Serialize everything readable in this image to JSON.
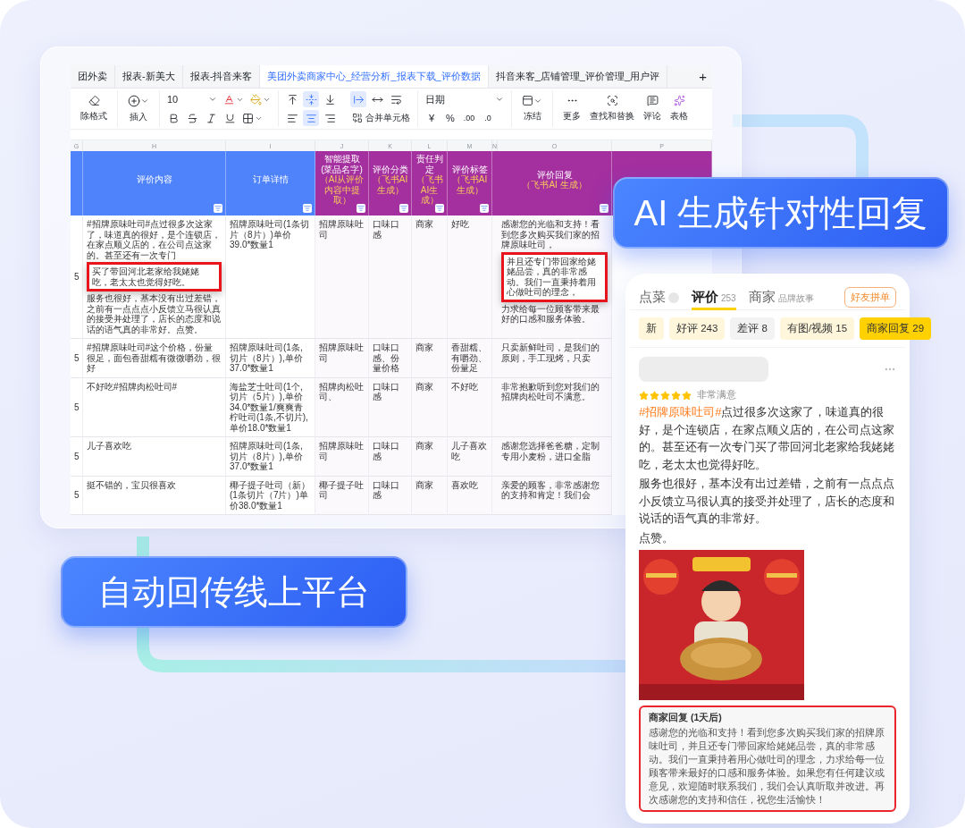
{
  "sheet": {
    "tabs": [
      {
        "label": "团外卖",
        "selected": false
      },
      {
        "label": "报表-新美大",
        "selected": false
      },
      {
        "label": "报表-抖音来客",
        "selected": false
      },
      {
        "label": "美团外卖商家中心_经营分析_报表下载_评价数据",
        "selected": true
      },
      {
        "label": "抖音来客_店铺管理_评价管理_用户评",
        "selected": false
      }
    ],
    "add_tab": "+",
    "toolbar": {
      "clear_format": "除格式",
      "insert": "插入",
      "font_size": "10",
      "vertical_align": [
        {
          "selected": false
        },
        {
          "selected": true
        },
        {
          "selected": false
        }
      ],
      "text_wrap": [
        {
          "selected": true
        },
        {
          "selected": false
        },
        {
          "selected": false
        }
      ],
      "horizontal_align": [
        {
          "selected": false
        },
        {
          "selected": true
        },
        {
          "selected": false
        }
      ],
      "merge_cells": "合并单元格",
      "number_format": "日期",
      "currency": "¥",
      "percent": "%",
      "add_decimal": ".00",
      "remove_decimal": ".0",
      "freeze": "冻结",
      "more": "更多",
      "find_replace": "查找和替换",
      "comment": "评论",
      "table": "表格"
    },
    "column_letters": [
      "G",
      "H",
      "I",
      "J",
      "K",
      "L",
      "M",
      "N",
      "O",
      "P"
    ],
    "headers": [
      {
        "kind": "source"
      },
      {
        "kind": "source",
        "title": "评价内容"
      },
      {
        "kind": "source",
        "title": "订单详情"
      },
      {
        "kind": "ai",
        "title": "智能提取(菜品名字)",
        "sub": "（AI从评价内容中提取）"
      },
      {
        "kind": "ai",
        "title": "评价分类",
        "sub": "（飞书AI生成）"
      },
      {
        "kind": "ai",
        "title": "责任判定",
        "sub": "（飞书AI生成）"
      },
      {
        "kind": "ai",
        "title": "评价标签",
        "sub": "（飞书AI 生成）"
      },
      {
        "kind": "ai"
      },
      {
        "kind": "ai",
        "title": "评价回复",
        "sub": "（飞书AI 生成）"
      },
      {
        "kind": "ai"
      }
    ],
    "rows": [
      {
        "cells": [
          "5",
          {
            "segments": [
              {
                "kind": "text",
                "text": "#招牌原味吐司#点过很多次这家了，味道真的很好，是个连锁店，在家点顺义店的，在公司点这家的。甚至还有一次专门"
              },
              {
                "kind": "highlight",
                "text": "买了带回河北老家给我姥姥吃，老太太也觉得好吃。"
              },
              {
                "kind": "text",
                "text": "服务也很好，基本没有出过差错，之前有一点点点小反馈立马很认真的接受并处理了，店长的态度和说话的语气真的非常好。点赞。"
              }
            ]
          },
          "招牌原味吐司(1条切片（8片）)单价39.0*数量1",
          "招牌原味吐司",
          "口味口感",
          "商家",
          "好吃",
          {
            "segments": [
              {
                "kind": "text",
                "text": "感谢您的光临和支持！看到您多次购买我们家的招牌原味吐司，"
              },
              {
                "kind": "highlight",
                "text": "并且还专门带回家给姥姥品尝，真的非常感动。我们一直秉持着用心做吐司的理念，"
              },
              {
                "kind": "text",
                "text": "力求给每一位顾客带来最好的口感和服务体验。"
              }
            ]
          }
        ]
      },
      {
        "cells": [
          "5",
          "#招牌原味吐司#这个价格，份量很足，面包香甜糯有微微嚼劲，很好",
          "招牌原味吐司(1条,切片（8片）),单价37.0*数量1",
          "招牌原味吐司",
          "口味口感、份量价格",
          "商家",
          "香甜糯、有嚼劲、份量足",
          "只卖新鲜吐司，是我们的原则，手工现烤，只卖"
        ]
      },
      {
        "cells": [
          "5",
          "不好吃#招牌肉松吐司#",
          "海盐芝士吐司(1个,切片（5片）),单价34.0*数量1/爽爽青柠吐司(1条,不切片),单价18.0*数量1",
          "招牌肉松吐司、",
          "口味口感",
          "商家",
          "不好吃",
          "非常抱歉听到您对我们的招牌肉松吐司不满意。"
        ]
      },
      {
        "cells": [
          "5",
          "儿子喜欢吃",
          "招牌原味吐司(1条,切片（8片）),单价37.0*数量1",
          "招牌原味吐司",
          "口味口感",
          "商家",
          "儿子喜欢吃",
          "感谢您选择爸爸糖，定制专用小麦粉，进口全脂"
        ]
      },
      {
        "cells": [
          "5",
          "挺不错的，宝贝很喜欢",
          "椰子提子吐司（新）(1条切片（7片）)单价38.0*数量1",
          "椰子提子吐司",
          "口味口感",
          "商家",
          "喜欢吃",
          "亲爱的顾客，非常感谢您的支持和肯定！我们会"
        ]
      }
    ]
  },
  "callouts": [
    {
      "text": "AI 生成针对性回复"
    },
    {
      "text": "自动回传线上平台"
    }
  ],
  "phone": {
    "tabs": [
      {
        "label": "点菜",
        "selected": false
      },
      {
        "label": "评价",
        "count": "253",
        "selected": true
      },
      {
        "label": "商家",
        "count": "品牌故事",
        "selected": false
      }
    ],
    "group_order": "好友拼单",
    "filters": [
      {
        "label": "新",
        "kind": "good",
        "selected": false
      },
      {
        "label": "好评 243",
        "kind": "good",
        "selected": false
      },
      {
        "label": "差评 8",
        "kind": "bad",
        "selected": false
      },
      {
        "label": "有图/视频 15",
        "kind": "good",
        "selected": false
      },
      {
        "label": "商家回复 29",
        "kind": "good",
        "selected": true
      }
    ],
    "review": {
      "stars": 5,
      "rating": "非常满意",
      "tag": "#招牌原味吐司#",
      "paragraphs": [
        "点过很多次这家了，味道真的很好，是个连锁店，在家点顺义店的，在公司点这家的。甚至还有一次专门买了带回河北老家给我姥姥吃，老太太也觉得好吃。",
        "服务也很好，基本没有出过差错，之前有一点点点小反馈立马很认真的接受并处理了，店长的态度和说话的语气真的非常好。",
        "点赞。"
      ]
    },
    "reply": {
      "title": "商家回复 (1天后)",
      "text": "感谢您的光临和支持！看到您多次购买我们家的招牌原味吐司，并且还专门带回家给姥姥品尝，真的非常感动。我们一直秉持着用心做吐司的理念，力求给每一位顾客带来最好的口感和服务体验。如果您有任何建议或意见，欢迎随时联系我们，我们会认真听取并改进。再次感谢您的支持和信任，祝您生活愉快！"
    }
  }
}
